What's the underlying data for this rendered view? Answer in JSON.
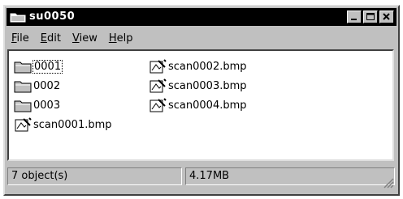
{
  "window": {
    "title": "su0050"
  },
  "menu": [
    {
      "mnemonic": "F",
      "rest": "ile"
    },
    {
      "mnemonic": "E",
      "rest": "dit"
    },
    {
      "mnemonic": "V",
      "rest": "iew"
    },
    {
      "mnemonic": "H",
      "rest": "elp"
    }
  ],
  "items": [
    {
      "label": "0001",
      "type": "folder",
      "selected": true
    },
    {
      "label": "0002",
      "type": "folder"
    },
    {
      "label": "0003",
      "type": "folder"
    },
    {
      "label": "scan0001.bmp",
      "type": "bitmap"
    },
    {
      "label": "scan0002.bmp",
      "type": "bitmap"
    },
    {
      "label": "scan0003.bmp",
      "type": "bitmap"
    },
    {
      "label": "scan0004.bmp",
      "type": "bitmap"
    }
  ],
  "status": {
    "count": "7 object(s)",
    "size": "4.17MB"
  },
  "colors": {
    "titlebar": "#000000",
    "face": "#c0c0c0",
    "folder": "#c0c0c0"
  }
}
